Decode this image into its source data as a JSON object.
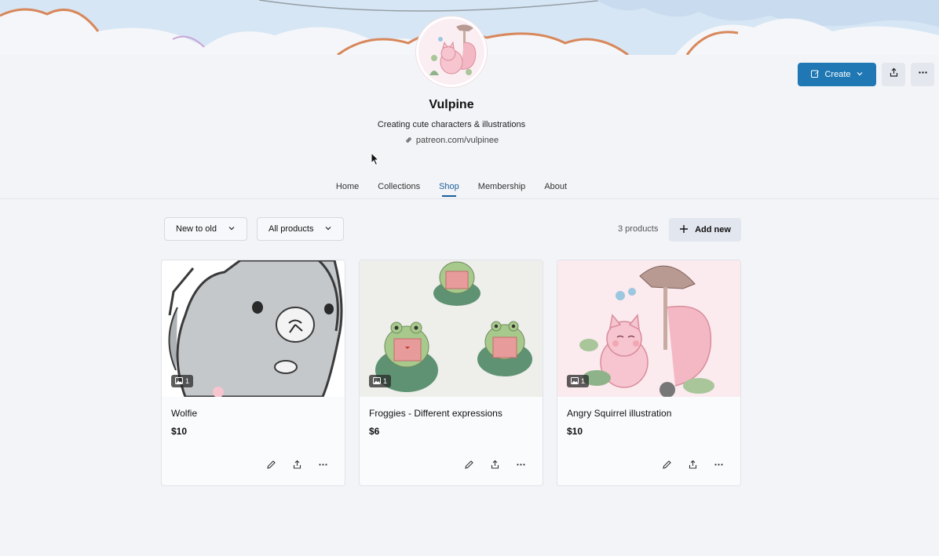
{
  "profile": {
    "name": "Vulpine",
    "tagline": "Creating cute characters & illustrations",
    "link": "patreon.com/vulpinee"
  },
  "actions": {
    "create_label": "Create",
    "icons": [
      "pencil-icon",
      "chevron-down-icon",
      "share-icon",
      "more-icon"
    ]
  },
  "nav": {
    "tabs": [
      {
        "label": "Home",
        "active": false
      },
      {
        "label": "Collections",
        "active": false
      },
      {
        "label": "Shop",
        "active": true
      },
      {
        "label": "Membership",
        "active": false
      },
      {
        "label": "About",
        "active": false
      }
    ]
  },
  "shop": {
    "sort_label": "New to old",
    "filter_label": "All products",
    "count_label": "3 products",
    "add_label": "Add new",
    "products": [
      {
        "title": "Wolfie",
        "price": "$10",
        "image_count": "1"
      },
      {
        "title": "Froggies - Different expressions",
        "price": "$6",
        "image_count": "1"
      },
      {
        "title": "Angry Squirrel illustration",
        "price": "$10",
        "image_count": "1"
      }
    ]
  },
  "colors": {
    "accent": "#1f77b4",
    "active_tab": "#1a5f9a",
    "background": "#f3f4f8"
  }
}
